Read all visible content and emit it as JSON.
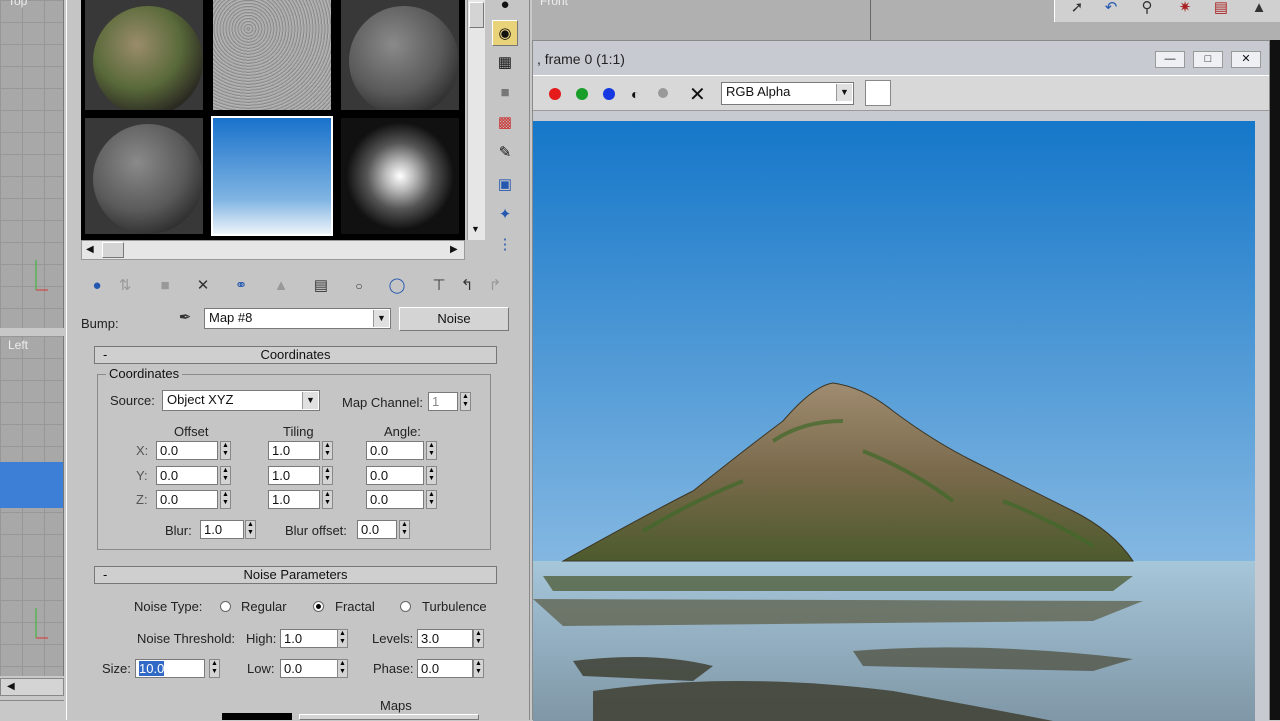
{
  "viewports": {
    "top_label": "Top",
    "left_label": "Left",
    "front_label": "Front"
  },
  "bump": {
    "label": "Bump:",
    "map_name": "Map #8",
    "map_type": "Noise"
  },
  "coordinates": {
    "rollout_title": "Coordinates",
    "group_title": "Coordinates",
    "source_label": "Source:",
    "source_value": "Object XYZ",
    "map_channel_label": "Map Channel:",
    "map_channel_value": "1",
    "col_offset": "Offset",
    "col_tiling": "Tiling",
    "col_angle": "Angle:",
    "rows": [
      {
        "axis": "X:",
        "offset": "0.0",
        "tiling": "1.0",
        "angle": "0.0"
      },
      {
        "axis": "Y:",
        "offset": "0.0",
        "tiling": "1.0",
        "angle": "0.0"
      },
      {
        "axis": "Z:",
        "offset": "0.0",
        "tiling": "1.0",
        "angle": "0.0"
      }
    ],
    "blur_label": "Blur:",
    "blur_value": "1.0",
    "blur_offset_label": "Blur offset:",
    "blur_offset_value": "0.0"
  },
  "noise": {
    "rollout_title": "Noise Parameters",
    "type_label": "Noise Type:",
    "types": [
      "Regular",
      "Fractal",
      "Turbulence"
    ],
    "selected_type": "Fractal",
    "threshold_label": "Noise Threshold:",
    "high_label": "High:",
    "high_value": "1.0",
    "levels_label": "Levels:",
    "levels_value": "3.0",
    "size_label": "Size:",
    "size_value": "10.0",
    "low_label": "Low:",
    "low_value": "0.0",
    "phase_label": "Phase:",
    "phase_value": "0.0",
    "maps_label": "Maps"
  },
  "render": {
    "title": ", frame 0 (1:1)",
    "channel_dropdown": "RGB Alpha"
  },
  "colors": {
    "sky_top": "#1577c9",
    "sky_bottom": "#b5d3e8",
    "red": "#e51a1a",
    "green": "#1a9e2a",
    "blue": "#1538e0"
  }
}
